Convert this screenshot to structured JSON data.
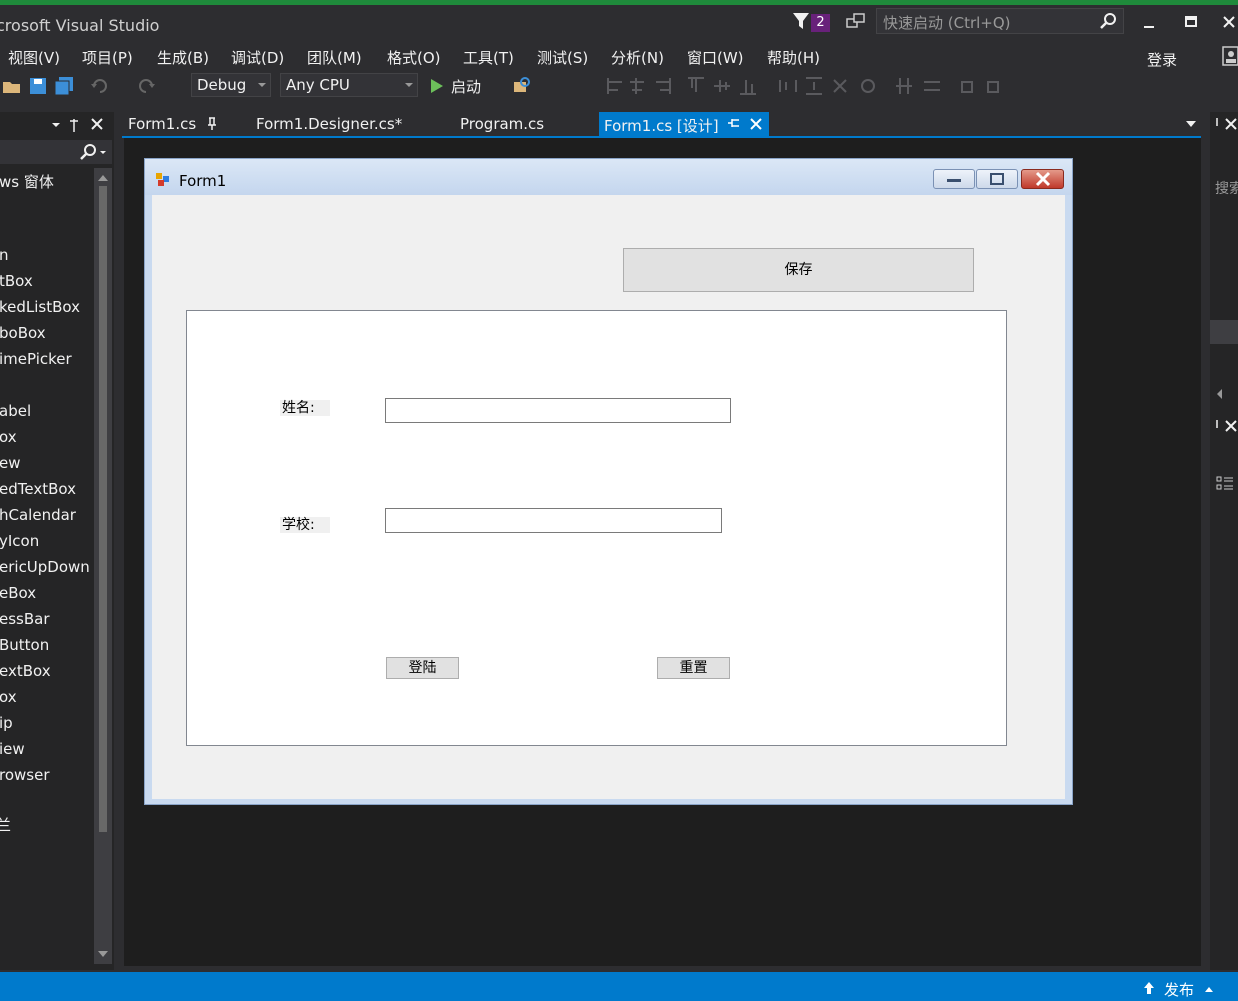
{
  "app": {
    "title": "crosoft Visual Studio",
    "notifications": "2"
  },
  "quick_launch": {
    "placeholder": "快速启动 (Ctrl+Q)"
  },
  "menu": [
    "视图(V)",
    "项目(P)",
    "生成(B)",
    "调试(D)",
    "团队(M)",
    "格式(O)",
    "工具(T)",
    "测试(S)",
    "分析(N)",
    "窗口(W)",
    "帮助(H)"
  ],
  "account": {
    "login": "登录"
  },
  "toolbar": {
    "config": "Debug",
    "platform": "Any CPU",
    "start": "启动"
  },
  "toolbox": {
    "items": [
      "ws 窗体",
      "n",
      "tBox",
      "kedListBox",
      "boBox",
      "imePicker",
      "abel",
      "ox",
      "ew",
      "edTextBox",
      "hCalendar",
      "yIcon",
      "ericUpDown",
      "eBox",
      "essBar",
      "Button",
      "extBox",
      "ox",
      "ip",
      "iew",
      "rowser",
      "兰"
    ]
  },
  "tabs": [
    "Form1.cs",
    "Form1.Designer.cs*",
    "Program.cs",
    "Form1.cs [设计]"
  ],
  "right_panel": {
    "search": "搜索"
  },
  "form": {
    "title": "Form1",
    "save_button": "保存",
    "name_label": "姓名:",
    "school_label": "学校:",
    "name_value": "",
    "school_value": "",
    "login_button": "登陆",
    "reset_button": "重置"
  },
  "status": {
    "publish": "发布"
  },
  "colors": {
    "accent": "#007acc",
    "badge": "#68217a",
    "close": "#c75050"
  }
}
